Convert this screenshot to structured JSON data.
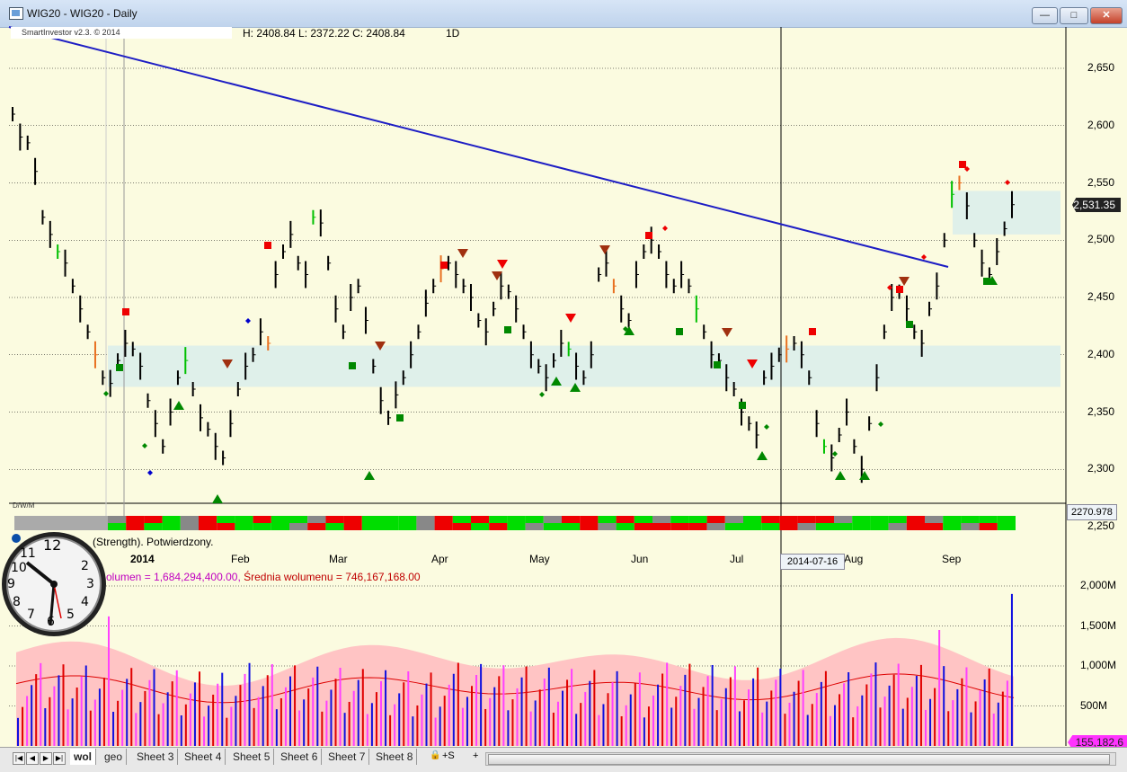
{
  "window": {
    "title": "WIG20 - WIG20 - Daily",
    "minimize": "—",
    "maximize": "□",
    "close": "✕"
  },
  "chart": {
    "signature": "SmartInvestor v2.3.  © 2014",
    "ohlc": "H: 2408.84  L: 2372.22  C: 2408.84",
    "interval": "1D",
    "dwm_label": "D/W/M",
    "strength_text": "(Strength). Potwierdzony.",
    "current_price": "2,531.35",
    "cursor_value": "2270.978",
    "cursor_date": "2014-07-16",
    "price_ticks": [
      "2,650",
      "2,600",
      "2,550",
      "2,500",
      "2,450",
      "2,400",
      "2,350",
      "2,300",
      "2,250"
    ],
    "months": [
      "2014",
      "Feb",
      "Mar",
      "Apr",
      "May",
      "Jun",
      "Jul",
      "Aug",
      "Sep"
    ]
  },
  "volume": {
    "info": "olumen = 1,684,294,400.00, ",
    "avg_label": "Średnia wolumenu = 746,167,168.00",
    "ticks": [
      "2,000M",
      "1,500M",
      "1,000M",
      "500M"
    ],
    "last_value": "155,182,6"
  },
  "tabs": [
    "wol",
    "geo",
    "Sheet 3",
    "Sheet 4",
    "Sheet 5",
    "Sheet 6",
    "Sheet 7",
    "Sheet 8"
  ],
  "active_tab": "wol",
  "tab_extras": {
    "lock": "🔒",
    "s": "+S",
    "arrow": "+"
  },
  "colors": {
    "trend_line": "#1d1dc4",
    "support_zone": "#dff0ea",
    "bull": "#00c000",
    "bear": "#e00000",
    "neutral": "#888888",
    "volume_pink": "#ff40ff",
    "volume_blue": "#1010e0",
    "volume_red": "#e00000"
  }
}
